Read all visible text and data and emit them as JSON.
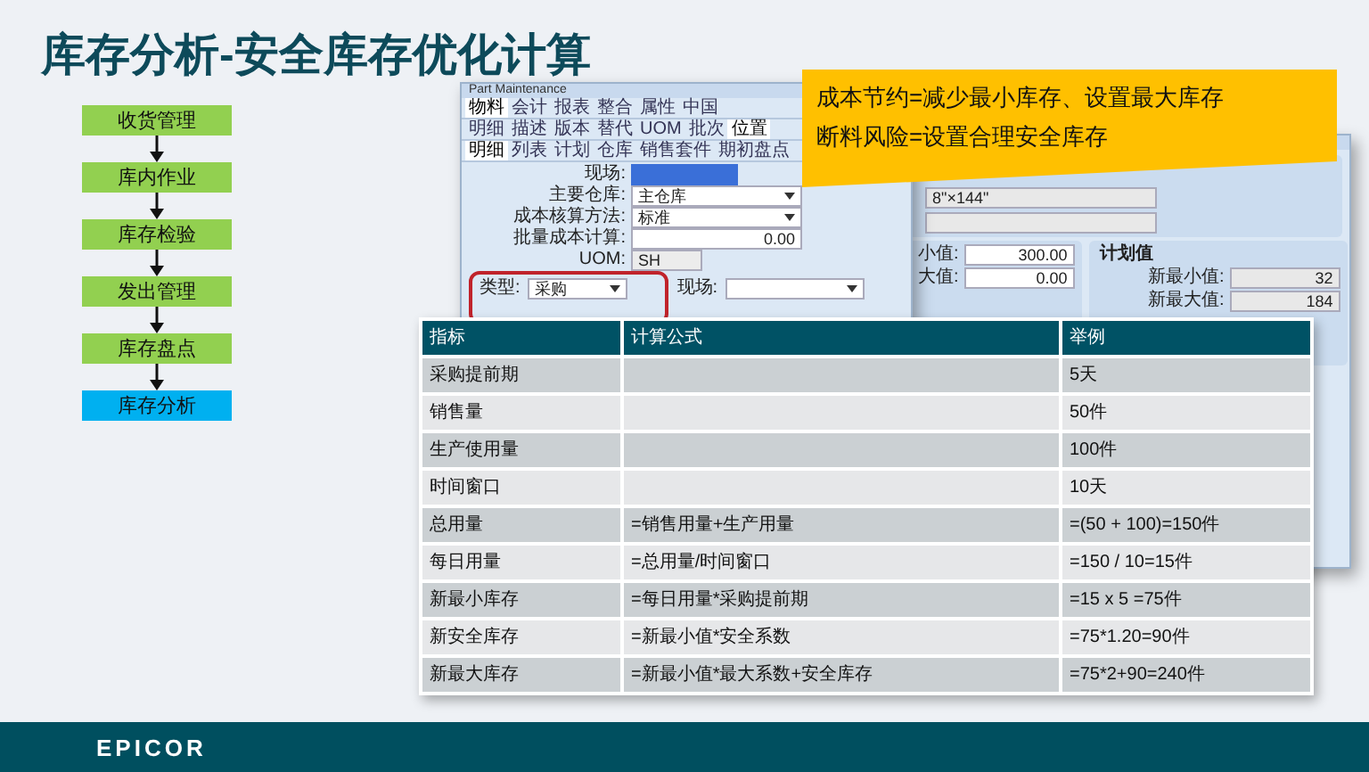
{
  "title": "库存分析-安全库存优化计算",
  "flow": [
    {
      "label": "收货管理",
      "selected": false
    },
    {
      "label": "库内作业",
      "selected": false
    },
    {
      "label": "库存检验",
      "selected": false
    },
    {
      "label": "发出管理",
      "selected": false
    },
    {
      "label": "库存盘点",
      "selected": false
    },
    {
      "label": "库存分析",
      "selected": true
    }
  ],
  "plan_window": {
    "top_field": {
      "value": "8\"×144\""
    },
    "left_group": {
      "fields": [
        {
          "label": "小值:",
          "value": "300.00"
        },
        {
          "label": "大值:",
          "value": "0.00"
        }
      ]
    },
    "right_group": {
      "title": "计划值",
      "fields": [
        {
          "label": "新最小值:",
          "value": "32"
        },
        {
          "label": "新最大值:",
          "value": "184"
        }
      ]
    }
  },
  "part_window": {
    "title": "Part Maintenance",
    "tab_rows": [
      [
        {
          "label": "物料",
          "selected": true
        },
        {
          "label": "会计",
          "selected": false
        },
        {
          "label": "报表",
          "selected": false
        },
        {
          "label": "整合",
          "selected": false
        },
        {
          "label": "属性",
          "selected": false
        },
        {
          "label": "中国",
          "selected": false
        }
      ],
      [
        {
          "label": "明细",
          "selected": false
        },
        {
          "label": "描述",
          "selected": false
        },
        {
          "label": "版本",
          "selected": false
        },
        {
          "label": "替代",
          "selected": false
        },
        {
          "label": "UOM",
          "selected": false
        },
        {
          "label": "批次",
          "selected": false
        },
        {
          "label": "位置",
          "selected": true
        }
      ],
      [
        {
          "label": "明细",
          "selected": true
        },
        {
          "label": "列表",
          "selected": false
        },
        {
          "label": "计划",
          "selected": false
        },
        {
          "label": "仓库",
          "selected": false
        },
        {
          "label": "销售套件",
          "selected": false
        },
        {
          "label": "期初盘点",
          "selected": false
        }
      ]
    ],
    "fields": [
      {
        "label": "现场:",
        "kind": "highlight"
      },
      {
        "label": "主要仓库:",
        "kind": "dropdown",
        "value": "主仓库"
      },
      {
        "label": "成本核算方法:",
        "kind": "dropdown",
        "value": "标准"
      },
      {
        "label": "批量成本计算:",
        "kind": "number",
        "value": "0.00"
      },
      {
        "label": "UOM:",
        "kind": "readonly",
        "value": "SH"
      }
    ],
    "group": {
      "highlighted": true,
      "fields": [
        {
          "label": "类型:",
          "kind": "dropdown",
          "value": "采购"
        },
        {
          "label": "现场:",
          "kind": "dropdown"
        }
      ]
    }
  },
  "callout": [
    "成本节约=减少最小库存、设置最大库存",
    "断料风险=设置合理安全库存"
  ],
  "table": {
    "columns": [
      "指标",
      "计算公式",
      "举例"
    ],
    "rows": [
      [
        "采购提前期",
        "",
        "5天"
      ],
      [
        "销售量",
        "",
        "50件"
      ],
      [
        "生产使用量",
        "",
        "100件"
      ],
      [
        "时间窗口",
        "",
        "10天"
      ],
      [
        "总用量",
        "=销售用量+生产用量",
        "=(50 + 100)=150件"
      ],
      [
        "每日用量",
        "=总用量/时间窗口",
        "=150 / 10=15件"
      ],
      [
        "新最小库存",
        "=每日用量*采购提前期",
        "=15 x 5 =75件"
      ],
      [
        "新安全库存",
        "=新最小值*安全系数",
        "=75*1.20=90件"
      ],
      [
        "新最大库存",
        "=新最小值*最大系数+安全库存",
        "=75*2+90=240件"
      ]
    ]
  },
  "footer": {
    "logo": "EPICOR"
  }
}
